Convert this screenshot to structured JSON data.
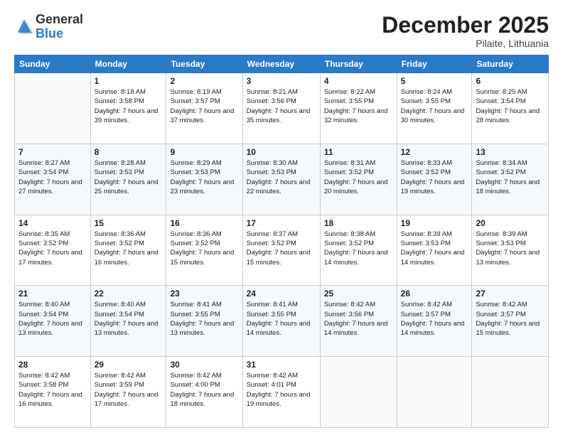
{
  "logo": {
    "general": "General",
    "blue": "Blue"
  },
  "title": "December 2025",
  "subtitle": "Pilaite, Lithuania",
  "days_of_week": [
    "Sunday",
    "Monday",
    "Tuesday",
    "Wednesday",
    "Thursday",
    "Friday",
    "Saturday"
  ],
  "weeks": [
    [
      {
        "day": "",
        "sunrise": "",
        "sunset": "",
        "daylight": ""
      },
      {
        "day": "1",
        "sunrise": "Sunrise: 8:18 AM",
        "sunset": "Sunset: 3:58 PM",
        "daylight": "Daylight: 7 hours and 39 minutes."
      },
      {
        "day": "2",
        "sunrise": "Sunrise: 8:19 AM",
        "sunset": "Sunset: 3:57 PM",
        "daylight": "Daylight: 7 hours and 37 minutes."
      },
      {
        "day": "3",
        "sunrise": "Sunrise: 8:21 AM",
        "sunset": "Sunset: 3:56 PM",
        "daylight": "Daylight: 7 hours and 35 minutes."
      },
      {
        "day": "4",
        "sunrise": "Sunrise: 8:22 AM",
        "sunset": "Sunset: 3:55 PM",
        "daylight": "Daylight: 7 hours and 32 minutes."
      },
      {
        "day": "5",
        "sunrise": "Sunrise: 8:24 AM",
        "sunset": "Sunset: 3:55 PM",
        "daylight": "Daylight: 7 hours and 30 minutes."
      },
      {
        "day": "6",
        "sunrise": "Sunrise: 8:25 AM",
        "sunset": "Sunset: 3:54 PM",
        "daylight": "Daylight: 7 hours and 28 minutes."
      }
    ],
    [
      {
        "day": "7",
        "sunrise": "Sunrise: 8:27 AM",
        "sunset": "Sunset: 3:54 PM",
        "daylight": "Daylight: 7 hours and 27 minutes."
      },
      {
        "day": "8",
        "sunrise": "Sunrise: 8:28 AM",
        "sunset": "Sunset: 3:53 PM",
        "daylight": "Daylight: 7 hours and 25 minutes."
      },
      {
        "day": "9",
        "sunrise": "Sunrise: 8:29 AM",
        "sunset": "Sunset: 3:53 PM",
        "daylight": "Daylight: 7 hours and 23 minutes."
      },
      {
        "day": "10",
        "sunrise": "Sunrise: 8:30 AM",
        "sunset": "Sunset: 3:53 PM",
        "daylight": "Daylight: 7 hours and 22 minutes."
      },
      {
        "day": "11",
        "sunrise": "Sunrise: 8:31 AM",
        "sunset": "Sunset: 3:52 PM",
        "daylight": "Daylight: 7 hours and 20 minutes."
      },
      {
        "day": "12",
        "sunrise": "Sunrise: 8:33 AM",
        "sunset": "Sunset: 3:52 PM",
        "daylight": "Daylight: 7 hours and 19 minutes."
      },
      {
        "day": "13",
        "sunrise": "Sunrise: 8:34 AM",
        "sunset": "Sunset: 3:52 PM",
        "daylight": "Daylight: 7 hours and 18 minutes."
      }
    ],
    [
      {
        "day": "14",
        "sunrise": "Sunrise: 8:35 AM",
        "sunset": "Sunset: 3:52 PM",
        "daylight": "Daylight: 7 hours and 17 minutes."
      },
      {
        "day": "15",
        "sunrise": "Sunrise: 8:36 AM",
        "sunset": "Sunset: 3:52 PM",
        "daylight": "Daylight: 7 hours and 16 minutes."
      },
      {
        "day": "16",
        "sunrise": "Sunrise: 8:36 AM",
        "sunset": "Sunset: 3:52 PM",
        "daylight": "Daylight: 7 hours and 15 minutes."
      },
      {
        "day": "17",
        "sunrise": "Sunrise: 8:37 AM",
        "sunset": "Sunset: 3:52 PM",
        "daylight": "Daylight: 7 hours and 15 minutes."
      },
      {
        "day": "18",
        "sunrise": "Sunrise: 8:38 AM",
        "sunset": "Sunset: 3:52 PM",
        "daylight": "Daylight: 7 hours and 14 minutes."
      },
      {
        "day": "19",
        "sunrise": "Sunrise: 8:39 AM",
        "sunset": "Sunset: 3:53 PM",
        "daylight": "Daylight: 7 hours and 14 minutes."
      },
      {
        "day": "20",
        "sunrise": "Sunrise: 8:39 AM",
        "sunset": "Sunset: 3:53 PM",
        "daylight": "Daylight: 7 hours and 13 minutes."
      }
    ],
    [
      {
        "day": "21",
        "sunrise": "Sunrise: 8:40 AM",
        "sunset": "Sunset: 3:54 PM",
        "daylight": "Daylight: 7 hours and 13 minutes."
      },
      {
        "day": "22",
        "sunrise": "Sunrise: 8:40 AM",
        "sunset": "Sunset: 3:54 PM",
        "daylight": "Daylight: 7 hours and 13 minutes."
      },
      {
        "day": "23",
        "sunrise": "Sunrise: 8:41 AM",
        "sunset": "Sunset: 3:55 PM",
        "daylight": "Daylight: 7 hours and 13 minutes."
      },
      {
        "day": "24",
        "sunrise": "Sunrise: 8:41 AM",
        "sunset": "Sunset: 3:55 PM",
        "daylight": "Daylight: 7 hours and 14 minutes."
      },
      {
        "day": "25",
        "sunrise": "Sunrise: 8:42 AM",
        "sunset": "Sunset: 3:56 PM",
        "daylight": "Daylight: 7 hours and 14 minutes."
      },
      {
        "day": "26",
        "sunrise": "Sunrise: 8:42 AM",
        "sunset": "Sunset: 3:57 PM",
        "daylight": "Daylight: 7 hours and 14 minutes."
      },
      {
        "day": "27",
        "sunrise": "Sunrise: 8:42 AM",
        "sunset": "Sunset: 3:57 PM",
        "daylight": "Daylight: 7 hours and 15 minutes."
      }
    ],
    [
      {
        "day": "28",
        "sunrise": "Sunrise: 8:42 AM",
        "sunset": "Sunset: 3:58 PM",
        "daylight": "Daylight: 7 hours and 16 minutes."
      },
      {
        "day": "29",
        "sunrise": "Sunrise: 8:42 AM",
        "sunset": "Sunset: 3:59 PM",
        "daylight": "Daylight: 7 hours and 17 minutes."
      },
      {
        "day": "30",
        "sunrise": "Sunrise: 8:42 AM",
        "sunset": "Sunset: 4:00 PM",
        "daylight": "Daylight: 7 hours and 18 minutes."
      },
      {
        "day": "31",
        "sunrise": "Sunrise: 8:42 AM",
        "sunset": "Sunset: 4:01 PM",
        "daylight": "Daylight: 7 hours and 19 minutes."
      },
      {
        "day": "",
        "sunrise": "",
        "sunset": "",
        "daylight": ""
      },
      {
        "day": "",
        "sunrise": "",
        "sunset": "",
        "daylight": ""
      },
      {
        "day": "",
        "sunrise": "",
        "sunset": "",
        "daylight": ""
      }
    ]
  ]
}
